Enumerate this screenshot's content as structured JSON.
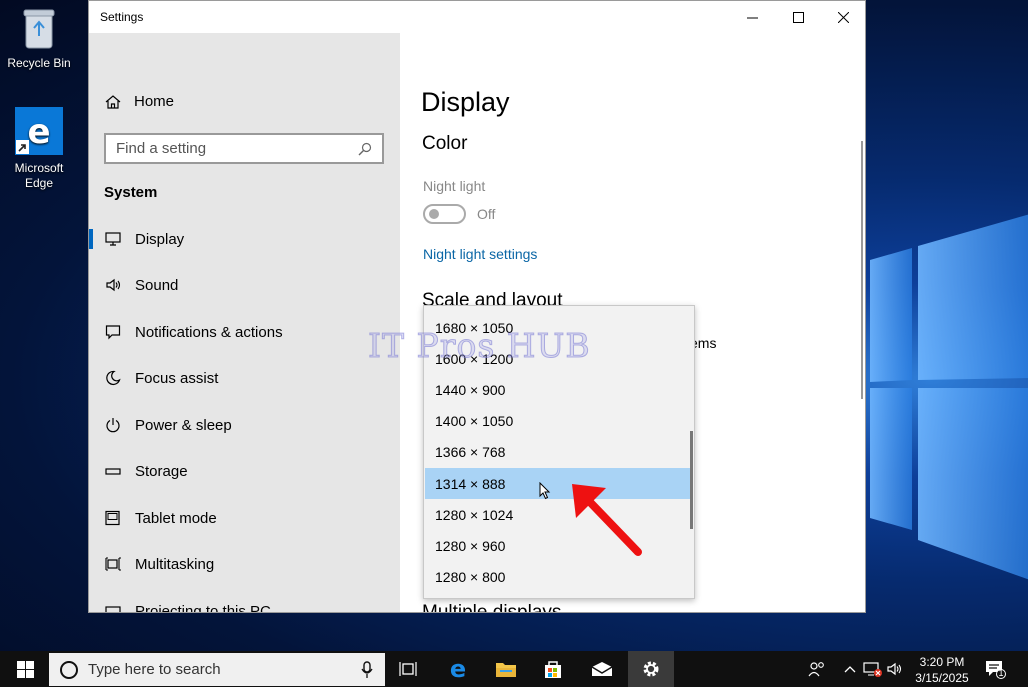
{
  "desktop": {
    "icons": [
      {
        "label": "Recycle Bin"
      },
      {
        "label": "Microsoft Edge"
      }
    ]
  },
  "window": {
    "title": "Settings",
    "controls": {
      "minimize": "—",
      "maximize": "☐",
      "close": "✕"
    }
  },
  "sidebar": {
    "home_label": "Home",
    "search_placeholder": "Find a setting",
    "section_label": "System",
    "items": [
      {
        "label": "Display",
        "icon": "monitor-icon"
      },
      {
        "label": "Sound",
        "icon": "speaker-icon"
      },
      {
        "label": "Notifications & actions",
        "icon": "notification-icon"
      },
      {
        "label": "Focus assist",
        "icon": "moon-icon"
      },
      {
        "label": "Power & sleep",
        "icon": "power-icon"
      },
      {
        "label": "Storage",
        "icon": "storage-icon"
      },
      {
        "label": "Tablet mode",
        "icon": "tablet-icon"
      },
      {
        "label": "Multitasking",
        "icon": "multitasking-icon"
      },
      {
        "label": "Projecting to this PC",
        "icon": "projector-icon"
      }
    ],
    "active_item": "Display"
  },
  "content": {
    "page_title": "Display",
    "color_heading": "Color",
    "night_light_label": "Night light",
    "night_light_state": "Off",
    "night_light_link": "Night light settings",
    "scale_heading": "Scale and layout",
    "partial_text": "ems",
    "multiple_displays_heading": "Multiple displays"
  },
  "watermark": "IT Pros HUB",
  "resolution_dropdown": {
    "options": [
      "1680 × 1050",
      "1600 × 1200",
      "1440 × 900",
      "1400 × 1050",
      "1366 × 768",
      "1314 × 888",
      "1280 × 1024",
      "1280 × 960",
      "1280 × 800"
    ],
    "highlighted": "1314 × 888"
  },
  "taskbar": {
    "search_placeholder": "Type here to search",
    "time": "3:20 PM",
    "date": "3/15/2025",
    "notification_count": "1",
    "accent": "#0067c0"
  }
}
